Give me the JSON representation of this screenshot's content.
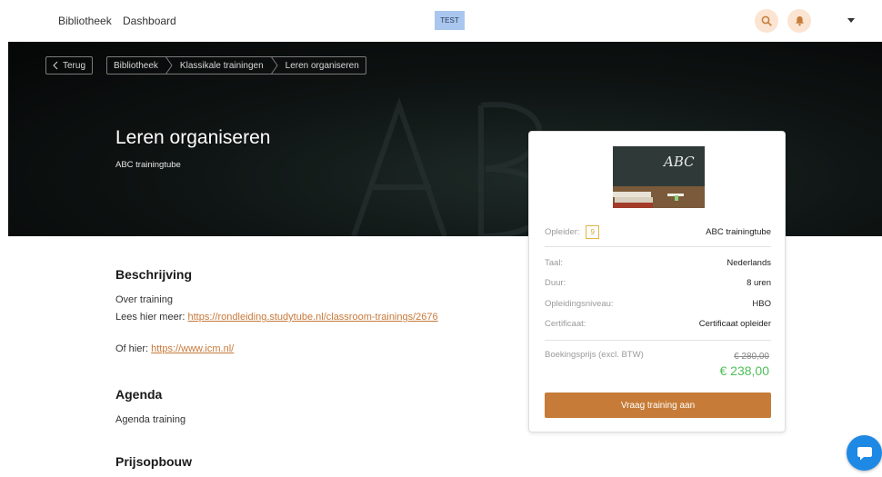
{
  "nav": {
    "library": "Bibliotheek",
    "dashboard": "Dashboard",
    "env_badge": "TEST"
  },
  "icons": {
    "search": "search-icon",
    "bell": "bell-icon",
    "account_menu": "chevron-down-icon",
    "chat": "chat-bubble-icon",
    "back": "chevron-left-icon"
  },
  "breadcrumb": {
    "back": "Terug",
    "items": [
      "Bibliotheek",
      "Klassikale trainingen",
      "Leren organiseren"
    ]
  },
  "hero": {
    "title": "Leren organiseren",
    "provider": "ABC trainingtube"
  },
  "description": {
    "heading": "Beschrijving",
    "line1": "Over training",
    "line2_prefix": "Lees hier meer: ",
    "line2_link": "https://rondleiding.studytube.nl/classroom-trainings/2676",
    "line3_prefix": "Of hier: ",
    "line3_link": "https://www.icm.nl/"
  },
  "agenda": {
    "heading": "Agenda",
    "text": "Agenda training"
  },
  "pricing": {
    "heading": "Prijsopbouw"
  },
  "card": {
    "thumbnail_text": "ABC",
    "provider_label": "Opleider:",
    "provider_score": "9",
    "provider_value": "ABC trainingtube",
    "language_label": "Taal:",
    "language_value": "Nederlands",
    "duration_label": "Duur:",
    "duration_value": "8 uren",
    "level_label": "Opleidingsniveau:",
    "level_value": "HBO",
    "certificate_label": "Certificaat:",
    "certificate_value": "Certificaat opleider",
    "price_label": "Boekingsprijs (excl. BTW)",
    "price_old": "€ 280,00",
    "price_new": "€ 238,00",
    "cta": "Vraag training aan"
  },
  "colors": {
    "accent": "#c67c38",
    "price_green": "#4fbf58",
    "link": "#c7793a",
    "chat_blue": "#1e88e5"
  }
}
